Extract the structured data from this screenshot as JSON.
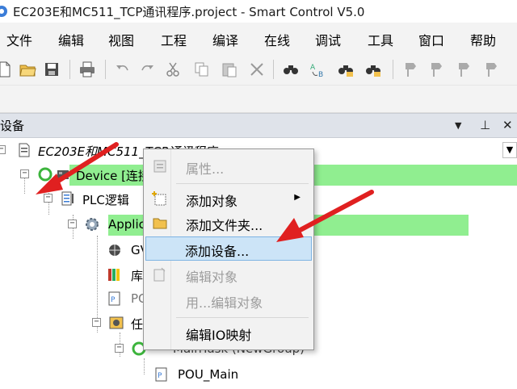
{
  "window": {
    "title": "EC203E和MC511_TCP通讯程序.project - Smart Control V5.0"
  },
  "menu": {
    "items": [
      "文件",
      "编辑",
      "视图",
      "工程",
      "编译",
      "在线",
      "调试",
      "工具",
      "窗口",
      "帮助"
    ]
  },
  "toolbar": {
    "icons": [
      "new-file-icon",
      "open-folder-icon",
      "save-icon",
      "print-icon",
      "undo-icon",
      "redo-icon",
      "cut-icon",
      "copy-icon",
      "paste-icon",
      "delete-icon",
      "find-icon",
      "replace-icon",
      "find-next-icon",
      "find-prev-icon",
      "bookmark-icons"
    ]
  },
  "panel": {
    "title": "设备",
    "dropdown_glyph": "▼",
    "pin_glyph": "⊥",
    "close_glyph": "✕"
  },
  "tree": {
    "root_label": "EC203E和MC511_TCP通讯程序",
    "device_label": "Device [连接",
    "plc_logic_label": "PLC逻辑",
    "application_label": "Applicat",
    "gvl_label": "GV",
    "library_label": "库",
    "pou_label": "PC",
    "task_label": "任",
    "maintask_label": "MainTask (NewGroup)",
    "pou_main_label": "POU_Main"
  },
  "context_menu": {
    "items": [
      {
        "label": "属性...",
        "disabled": true,
        "icon": "properties-icon"
      },
      {
        "label": "添加对象",
        "disabled": false,
        "icon": "add-object-icon",
        "submenu": true
      },
      {
        "label": "添加文件夹...",
        "disabled": false,
        "icon": "folder-icon"
      },
      {
        "label": "添加设备...",
        "disabled": false,
        "icon": "",
        "highlighted": true
      },
      {
        "label": "编辑对象",
        "disabled": true,
        "icon": "edit-object-icon"
      },
      {
        "label": "用...编辑对象",
        "disabled": true,
        "icon": ""
      },
      {
        "label": "编辑IO映射",
        "disabled": false,
        "icon": ""
      }
    ]
  },
  "colors": {
    "highlight_green": "#90ee90",
    "menu_hover": "#cce4f7",
    "arrow_red": "#e02020"
  }
}
